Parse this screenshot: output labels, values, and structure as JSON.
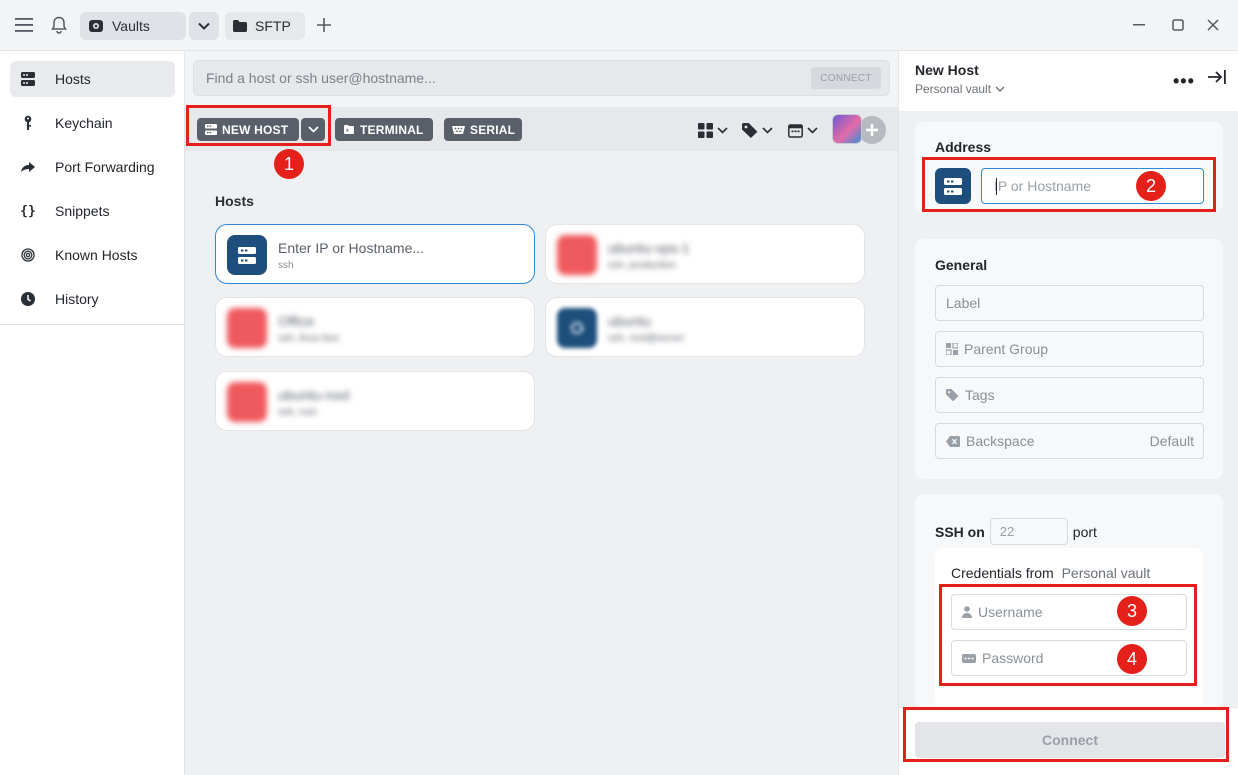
{
  "titlebar": {
    "tabs": [
      {
        "label": "Vaults",
        "icon": "vault-icon"
      },
      {
        "label": "SFTP",
        "icon": "folder-icon"
      }
    ]
  },
  "sidebar": {
    "items": [
      {
        "label": "Hosts",
        "icon": "hosts-icon",
        "active": true
      },
      {
        "label": "Keychain",
        "icon": "key-icon"
      },
      {
        "label": "Port Forwarding",
        "icon": "forward-icon"
      },
      {
        "label": "Snippets",
        "icon": "braces-icon"
      },
      {
        "label": "Known Hosts",
        "icon": "fingerprint-icon"
      },
      {
        "label": "History",
        "icon": "clock-icon"
      }
    ]
  },
  "main": {
    "search_placeholder": "Find a host or ssh user@hostname...",
    "connect_small": "CONNECT",
    "toolbar": {
      "new_host": "NEW HOST",
      "terminal": "TERMINAL",
      "serial": "SERIAL"
    },
    "hosts_title": "Hosts",
    "hosts": [
      {
        "name": "Enter IP or Hostname...",
        "sub": "ssh",
        "color": "#1d4e7c"
      },
      {
        "name": "ubuntu-vps-1",
        "sub": "ssh, production",
        "color": "#ef5a5e"
      },
      {
        "name": "Office",
        "sub": "ssh, linux-box",
        "color": "#ef5a5e"
      },
      {
        "name": "ubuntu",
        "sub": "ssh, root@server",
        "color": "#1d4e7c"
      },
      {
        "name": "ubuntu-root",
        "sub": "ssh, root",
        "color": "#ef5a5e"
      }
    ]
  },
  "panel": {
    "title": "New Host",
    "subtitle": "Personal vault",
    "address": {
      "title": "Address",
      "placeholder": "IP or Hostname"
    },
    "general": {
      "title": "General",
      "label_placeholder": "Label",
      "parent_group_placeholder": "Parent Group",
      "tags_placeholder": "Tags",
      "backspace_label": "Backspace",
      "backspace_value": "Default"
    },
    "ssh": {
      "prefix": "SSH on",
      "port": "22",
      "suffix": "port",
      "credentials_from": "Credentials from",
      "vault": "Personal vault",
      "username_placeholder": "Username",
      "password_placeholder": "Password"
    },
    "connect_label": "Connect"
  },
  "annotations": {
    "badges": [
      "1",
      "2",
      "3",
      "4"
    ],
    "color": "#e5201a"
  },
  "colors": {
    "accent_blue": "#2f87d8",
    "host_icon_navy": "#1d4e7c",
    "host_icon_red": "#ef5a5e",
    "toolbar_button": "#5a6069"
  }
}
